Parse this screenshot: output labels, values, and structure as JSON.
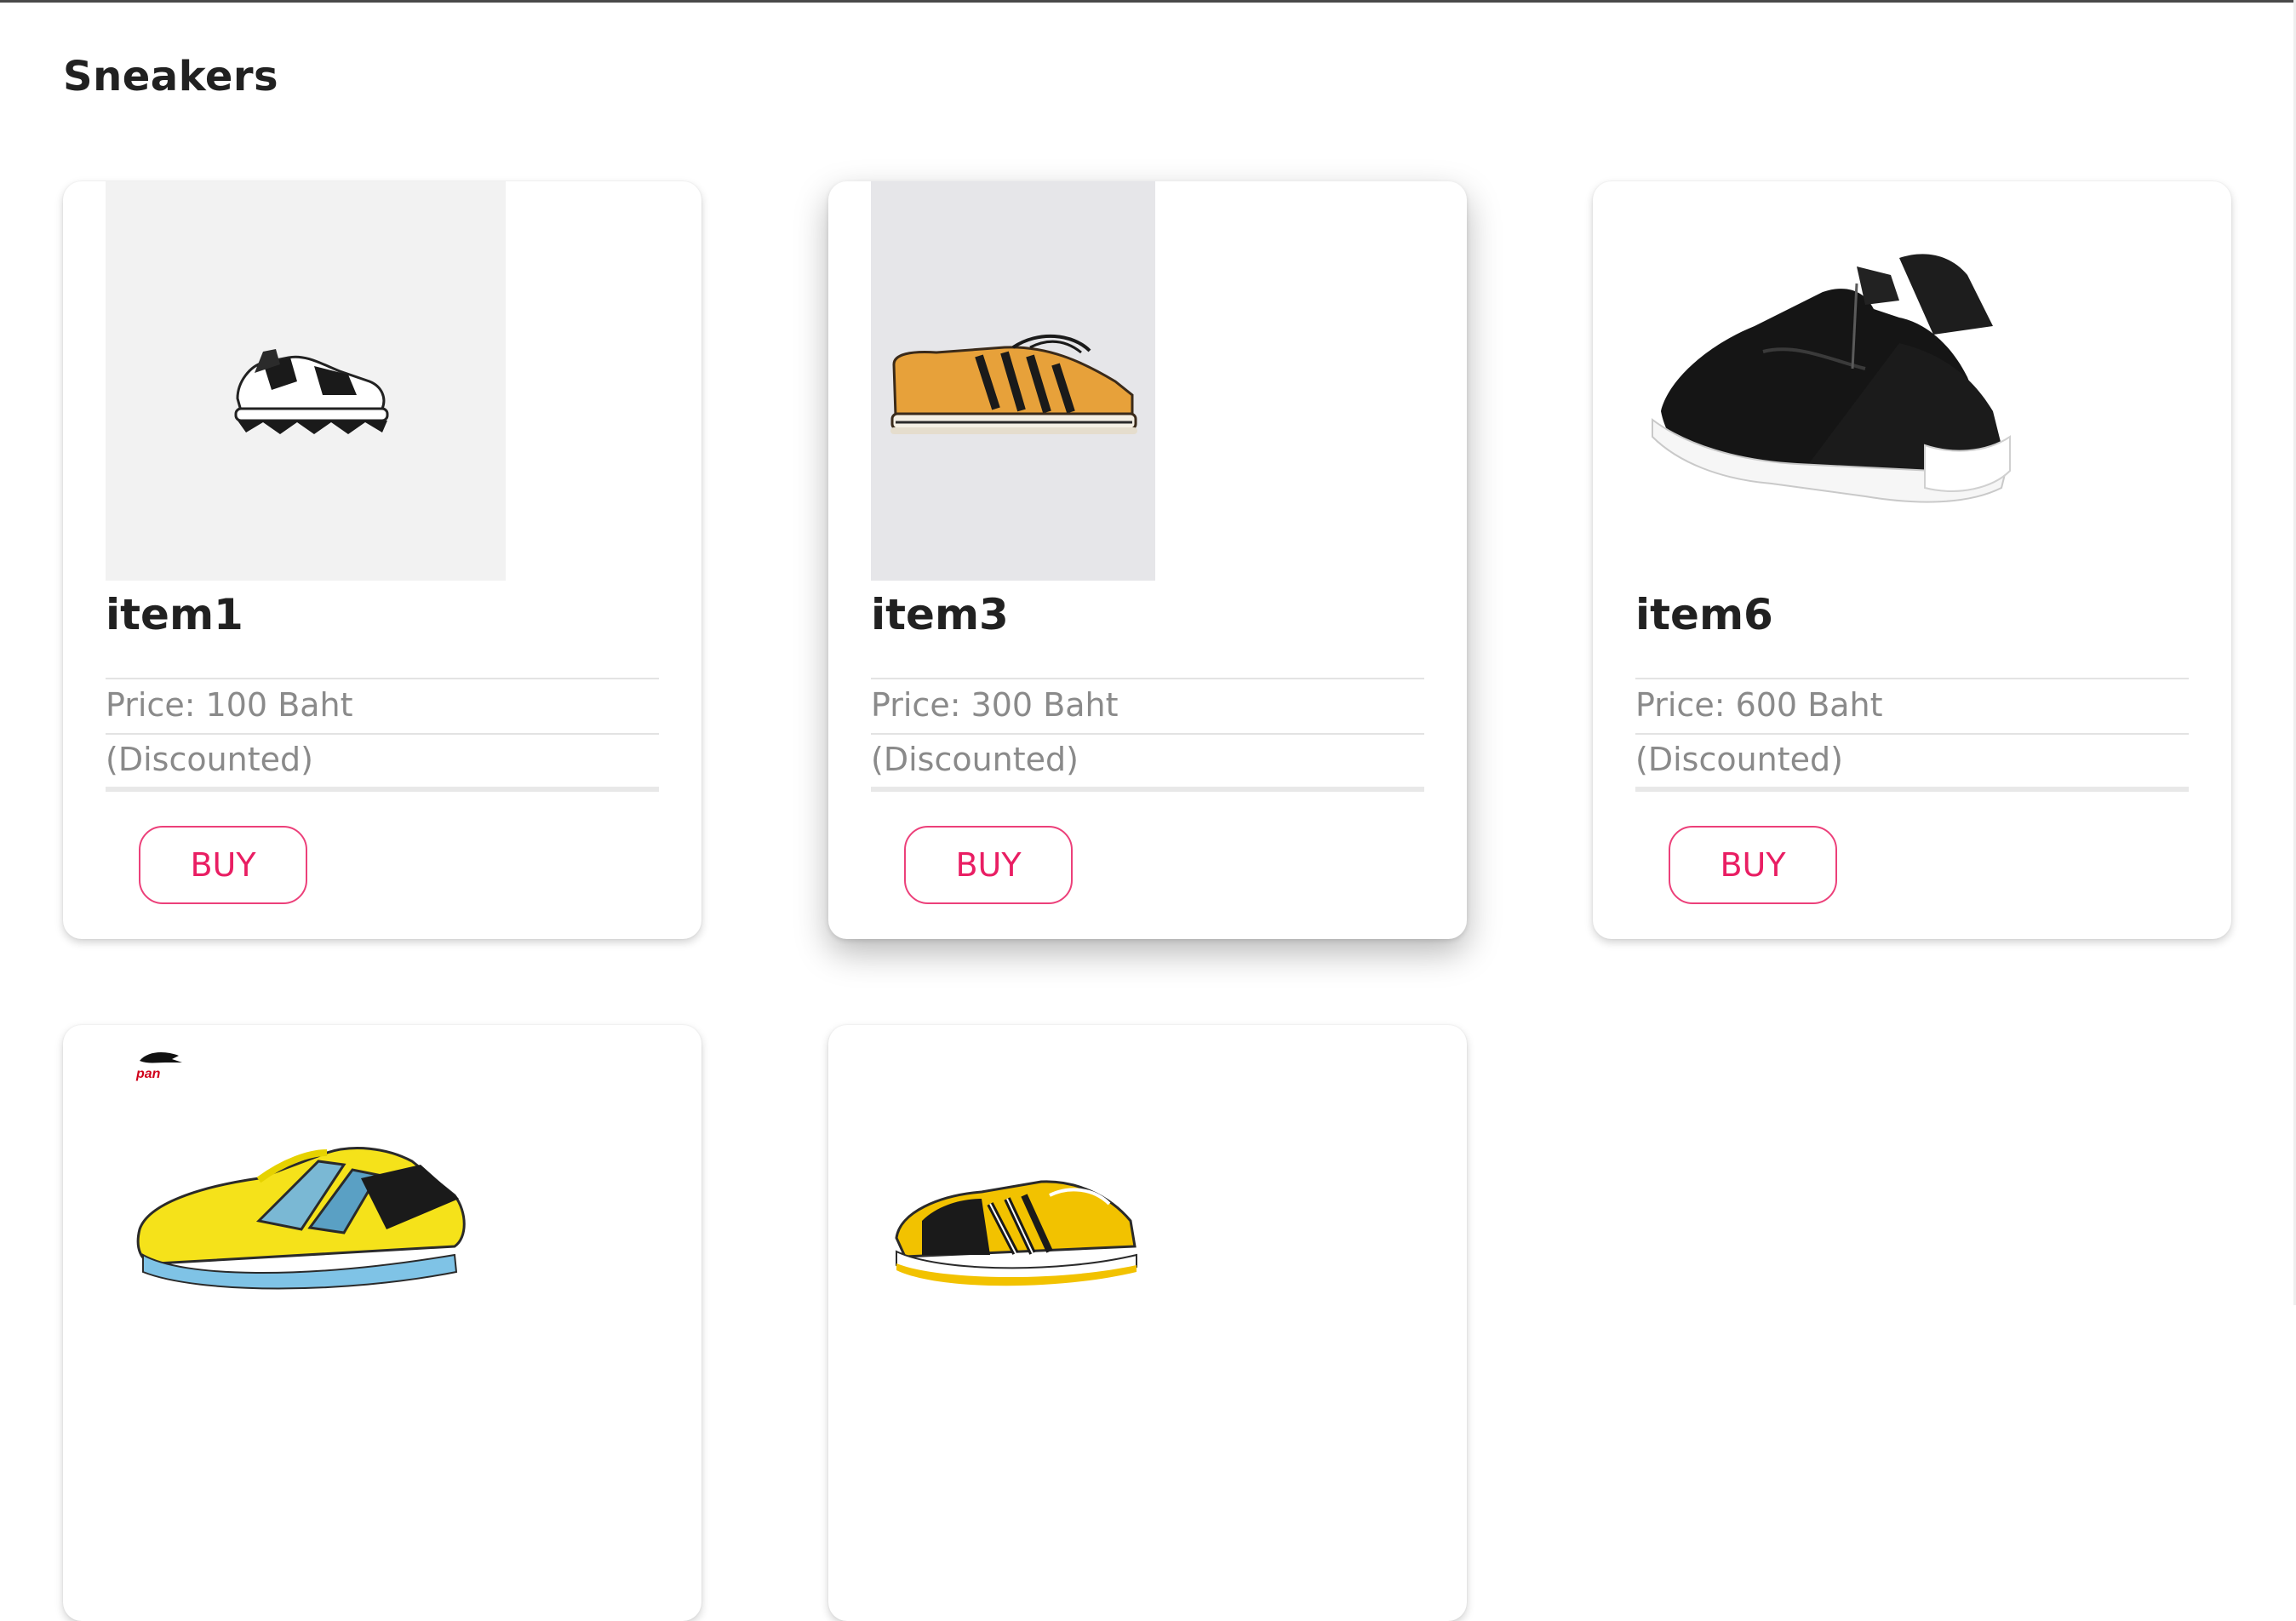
{
  "page": {
    "title": "Sneakers"
  },
  "products": [
    {
      "name": "item1",
      "price": "Price: 100 Baht",
      "note": "(Discounted)",
      "buy_label": "BUY",
      "image_icon": "white-black-chunky-sneaker-icon",
      "image_bg": "#f2f2f2"
    },
    {
      "name": "item3",
      "price": "Price: 300 Baht",
      "note": "(Discounted)",
      "buy_label": "BUY",
      "image_icon": "orange-striped-sneaker-icon",
      "image_bg": "#e6e6e9"
    },
    {
      "name": "item6",
      "price": "Price: 600 Baht",
      "note": "(Discounted)",
      "buy_label": "BUY",
      "image_icon": "black-zip-sneaker-icon",
      "image_bg": "#ffffff"
    },
    {
      "image_icon": "yellow-futsal-shoe-icon",
      "brand_logo_text": "pan",
      "image_bg": "#ffffff"
    },
    {
      "image_icon": "yellow-black-sneaker-icon",
      "image_bg": "#ffffff"
    }
  ],
  "colors": {
    "accent": "#e91e63",
    "accent_border": "#ec407a",
    "title_text": "#212121",
    "muted_text": "#8a8a8a",
    "divider": "#e3e3e3"
  }
}
